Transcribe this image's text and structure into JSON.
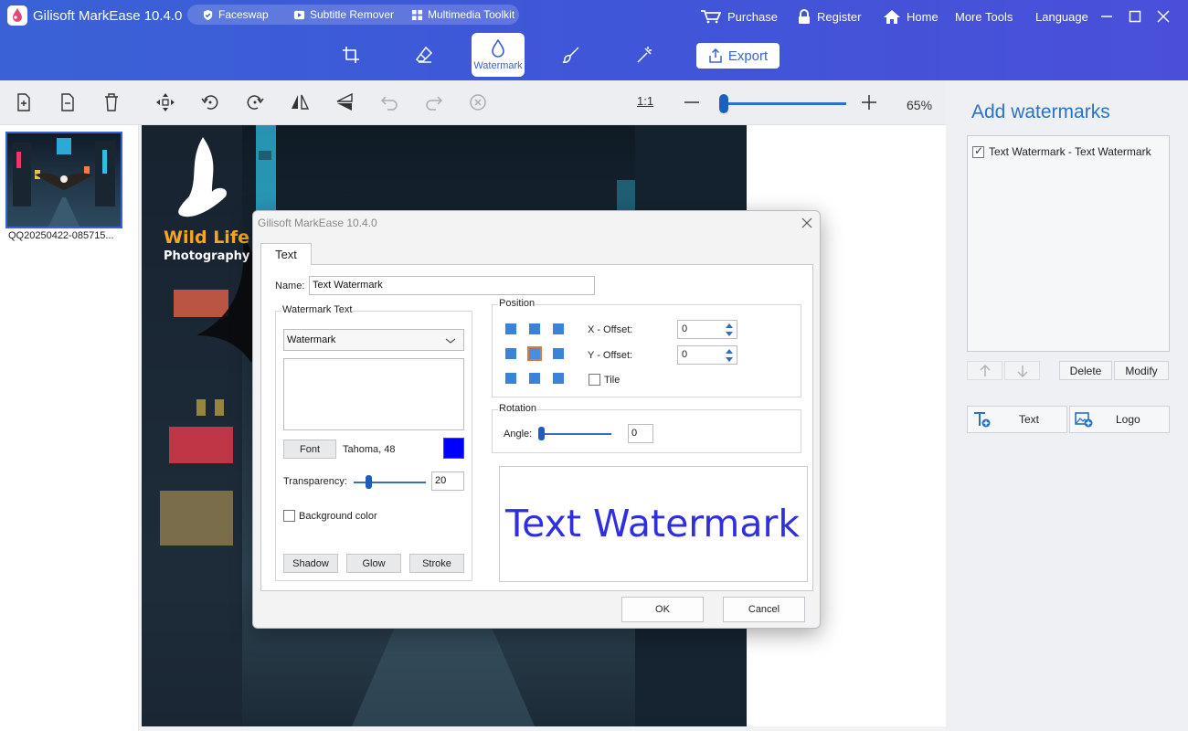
{
  "app": {
    "title": "Gilisoft MarkEase 10.4.0",
    "pills": [
      "Faceswap",
      "Subtitle Remover",
      "Multimedia Toolkit"
    ],
    "nav": {
      "purchase": "Purchase",
      "register": "Register",
      "home": "Home",
      "more_tools": "More Tools",
      "language": "Language"
    },
    "accent": "#3a62d6"
  },
  "tools": {
    "active_label": "Watermark",
    "export_label": "Export"
  },
  "zoom": {
    "fit_label": "1:1",
    "percent": "65%",
    "level": 0.05
  },
  "thumbnail": {
    "name": "QQ20250422-085715..."
  },
  "canvas": {
    "logo_line1": "Wild Life",
    "logo_line2": "Photography"
  },
  "panel": {
    "title": "Add watermarks",
    "items": [
      {
        "label": "Text Watermark - Text Watermark",
        "checked": true
      }
    ],
    "delete_label": "Delete",
    "modify_label": "Modify",
    "add_text_label": "Text",
    "add_logo_label": "Logo"
  },
  "dialog": {
    "title": "Gilisoft MarkEase 10.4.0",
    "tab": "Text",
    "name_label": "Name:",
    "name_value": "Text Watermark",
    "wm_text_group": "Watermark Text",
    "wm_text_select": "Watermark",
    "font_button": "Font",
    "font_value": "Tahoma, 48",
    "font_color": "#0000ff",
    "transparency_label": "Transparency:",
    "transparency_value": "20",
    "background_label": "Background color",
    "background_checked": false,
    "shadow_button": "Shadow",
    "glow_button": "Glow",
    "stroke_button": "Stroke",
    "position_group": "Position",
    "x_offset_label": "X - Offset:",
    "x_offset_value": "0",
    "y_offset_label": "Y - Offset:",
    "y_offset_value": "0",
    "tile_label": "Tile",
    "tile_checked": false,
    "selected_position": "middle-center",
    "rotation_group": "Rotation",
    "angle_label": "Angle:",
    "angle_value": "0",
    "preview_text": "Text Watermark",
    "preview_color": "#2f2fe0",
    "ok_label": "OK",
    "cancel_label": "Cancel"
  }
}
